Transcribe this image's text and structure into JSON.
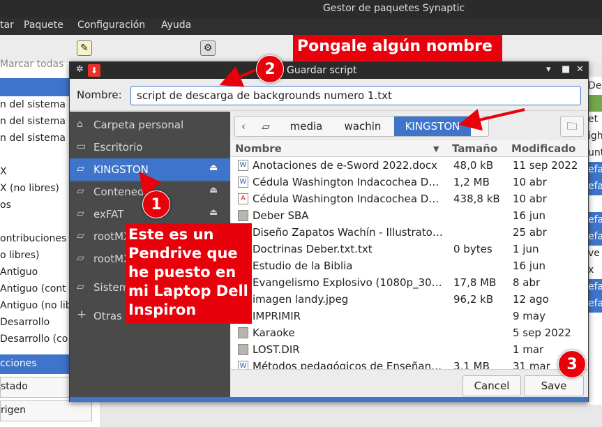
{
  "background_window": {
    "title": "Gestor de paquetes Synaptic",
    "menu": [
      "tar",
      "Paquete",
      "Configuración",
      "Ayuda"
    ],
    "mark_all": "Marcar todas",
    "left_items": [
      "n del sistema",
      "n del sistema",
      "n del sistema",
      "X",
      "X (no libres)",
      "os",
      "ontribuciones",
      "o libres)",
      "Antiguo",
      "Antiguo (cont",
      "Antiguo (no lib",
      "Desarrollo",
      "Desarrollo (co"
    ],
    "section_selected": "cciones",
    "bottom_buttons": [
      "stado",
      "rigen"
    ],
    "right_header": "Des",
    "right_items": [
      "et",
      "igh",
      "unt",
      "efa",
      "efa",
      "efa",
      "efa",
      "ve",
      "x",
      "efa",
      "efa"
    ]
  },
  "dialog": {
    "title": "Guardar script",
    "name_label": "Nombre:",
    "name_value": "script de descarga de backgrounds numero 1.txt",
    "sidebar": [
      {
        "label": "Carpeta personal",
        "icon": "home-icon",
        "ejectable": false
      },
      {
        "label": "Escritorio",
        "icon": "folder-icon",
        "ejectable": false
      },
      {
        "label": "KINGSTON",
        "icon": "drive-icon",
        "ejectable": true,
        "selected": true
      },
      {
        "label": "Contenedo",
        "icon": "drive-icon",
        "ejectable": true
      },
      {
        "label": "exFAT",
        "icon": "drive-icon",
        "ejectable": true
      },
      {
        "label": "rootMX",
        "icon": "drive-icon",
        "ejectable": false
      },
      {
        "label": "rootMX",
        "icon": "drive-icon",
        "ejectable": false
      },
      {
        "label": "Sistema",
        "icon": "drive-icon",
        "ejectable": false
      },
      {
        "label": "Otras",
        "icon": "plus-icon",
        "ejectable": false
      }
    ],
    "path": [
      "media",
      "wachin",
      "KINGSTON"
    ],
    "columns": {
      "name": "Nombre",
      "size": "Tamaño",
      "modified": "Modificado"
    },
    "files": [
      {
        "name": "Anotaciones de e-Sword 2022.docx",
        "size": "48,0 kB",
        "modified": "11 sep 2022",
        "type": "doc"
      },
      {
        "name": "Cédula Washington Indacochea D…",
        "size": "1,2 MB",
        "modified": "10 abr",
        "type": "doc"
      },
      {
        "name": "Cédula Washington Indacochea D…",
        "size": "438,8 kB",
        "modified": "10 abr",
        "type": "pdf"
      },
      {
        "name": "Deber SBA",
        "size": "",
        "modified": "16 jun",
        "type": "folder"
      },
      {
        "name": "Diseño Zapatos Wachín - Illustrato…",
        "size": "",
        "modified": "25 abr",
        "type": "folder"
      },
      {
        "name": "Doctrinas Deber.txt.txt",
        "size": "0 bytes",
        "modified": "1 jun",
        "type": "txt"
      },
      {
        "name": "Estudio de la Biblia",
        "size": "",
        "modified": "16 jun",
        "type": "folder"
      },
      {
        "name": "Evangelismo Explosivo (1080p_30…",
        "size": "17,8 MB",
        "modified": "8 abr",
        "type": "video"
      },
      {
        "name": "imagen landy.jpeg",
        "size": "96,2 kB",
        "modified": "12 ago",
        "type": "image"
      },
      {
        "name": "IMPRIMIR",
        "size": "",
        "modified": "9 may",
        "type": "folder"
      },
      {
        "name": "Karaoke",
        "size": "",
        "modified": "5 sep 2022",
        "type": "folder"
      },
      {
        "name": "LOST.DIR",
        "size": "",
        "modified": "1 mar",
        "type": "folder"
      },
      {
        "name": "Métodos pedagógicos de Enseñan…",
        "size": "3,1 MB",
        "modified": "31 mar",
        "type": "doc"
      }
    ],
    "cancel_label": "Cancel",
    "save_label": "Save"
  },
  "annotations": {
    "step2_number": "2",
    "step2_text": "Pongale algún nombre",
    "step1_number": "1",
    "step1_text": "Este es un Pendrive que he puesto en mi Laptop Dell Inspiron",
    "step3_number": "3"
  },
  "colors": {
    "accent": "#3e74c9",
    "annotation": "#e8000b",
    "sidebar": "#4a4a4a",
    "titlebar": "#2b2b2b"
  }
}
